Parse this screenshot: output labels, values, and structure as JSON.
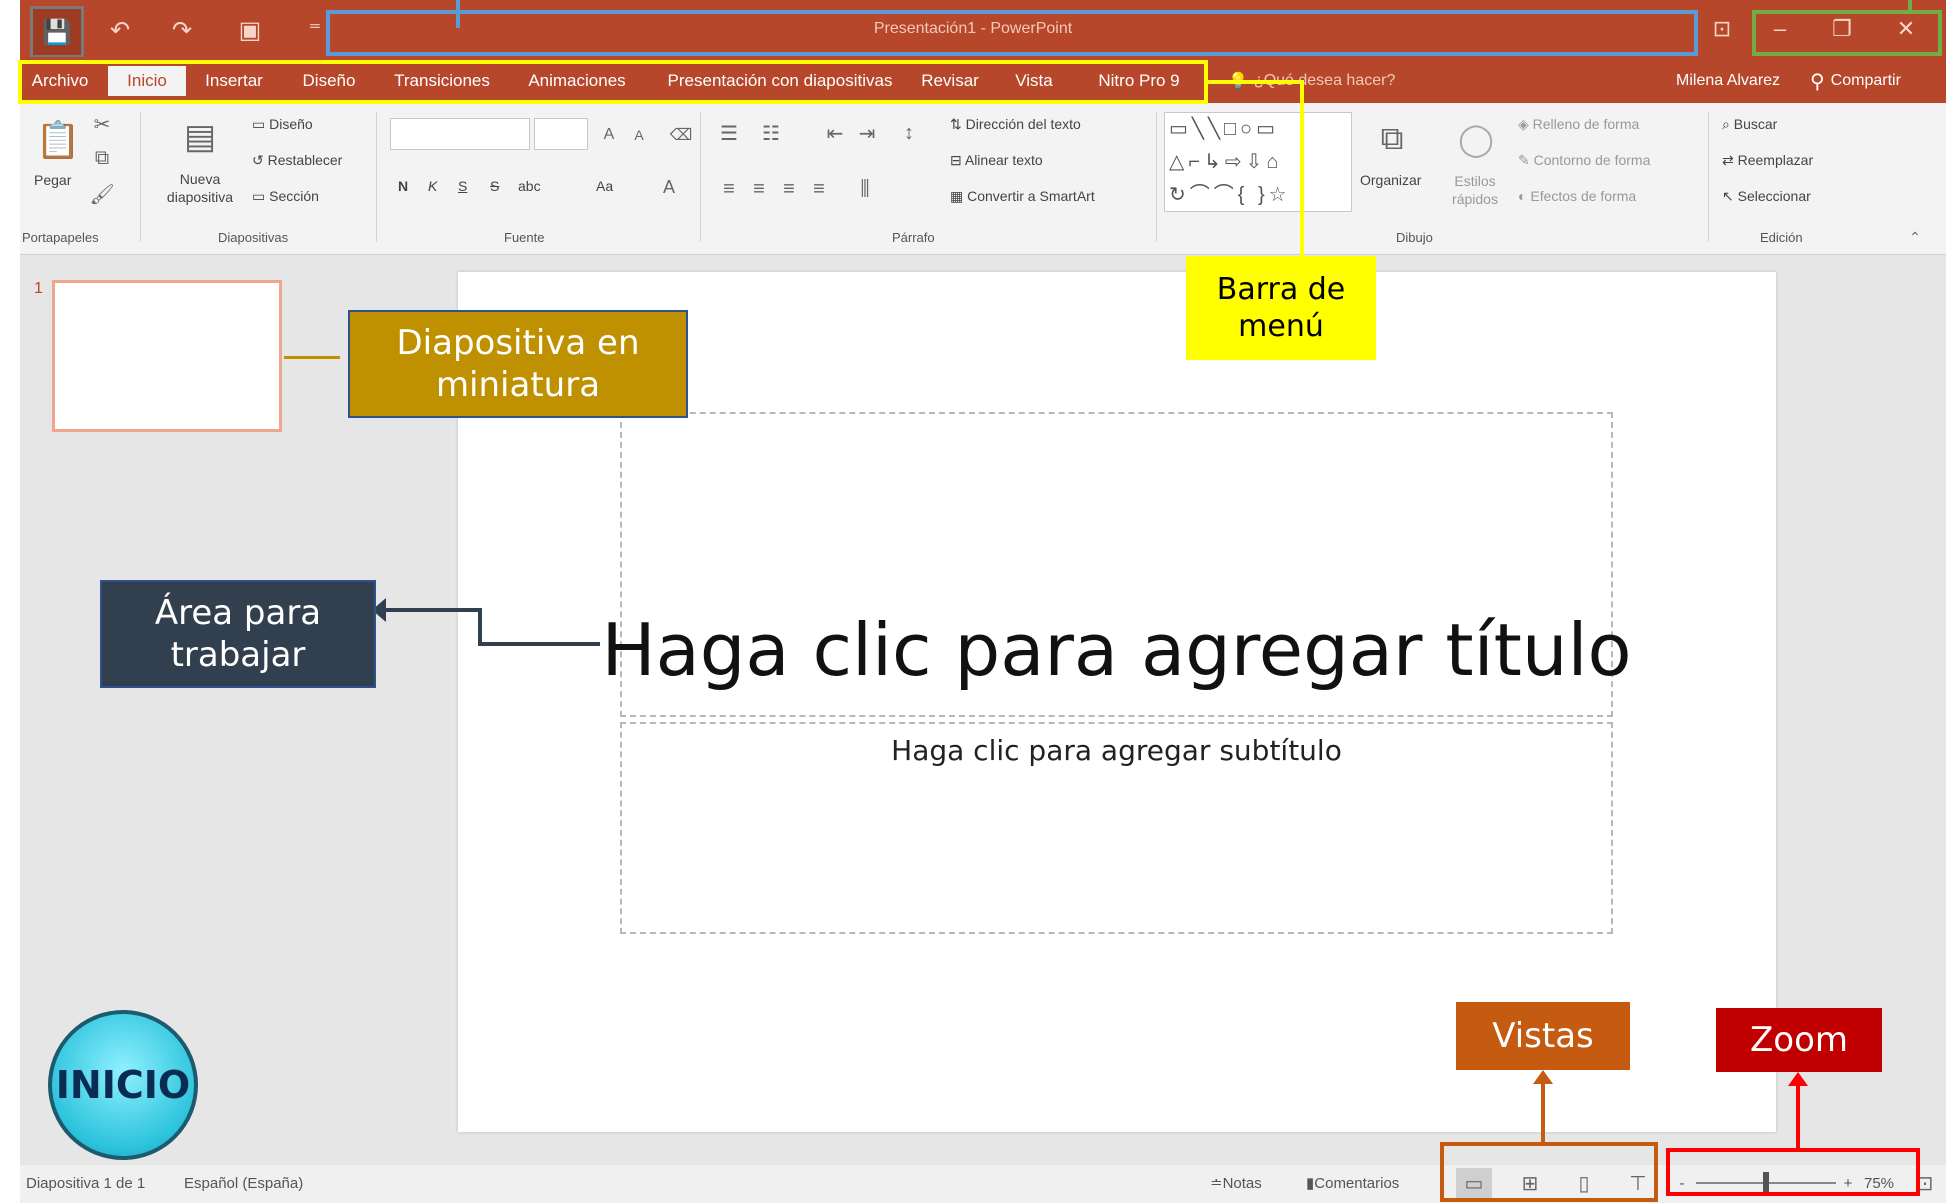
{
  "window": {
    "title": "Presentación1 - PowerPoint",
    "quick_access": {
      "save_icon": "save-icon",
      "undo_icon": "undo-icon",
      "redo_icon": "redo-icon",
      "present_icon": "present-icon",
      "customize_icon": "customize-icon"
    },
    "controls": {
      "ribbon_options": "ribbon-display-options-icon",
      "minimize": "–",
      "restore": "❐",
      "close": "✕"
    }
  },
  "tabs": [
    "Archivo",
    "Inicio",
    "Insertar",
    "Diseño",
    "Transiciones",
    "Animaciones",
    "Presentación con diapositivas",
    "Revisar",
    "Vista",
    "Nitro Pro 9"
  ],
  "active_tab": "Inicio",
  "tell_me": "¿Qué desea hacer?",
  "user_name": "Milena Alvarez",
  "share_label": "Compartir",
  "ribbon": {
    "clipboard": {
      "paste": "Pegar",
      "group": "Portapapeles"
    },
    "slides": {
      "new_slide": "Nueva diapositiva",
      "layout": "Diseño",
      "reset": "Restablecer",
      "section": "Sección",
      "group": "Diapositivas"
    },
    "font": {
      "bold": "N",
      "italic": "K",
      "underline": "S",
      "strike": "S",
      "spacing": "abc",
      "change_case": "Aa",
      "group": "Fuente"
    },
    "paragraph": {
      "text_direction": "Dirección del texto",
      "align_text": "Alinear texto",
      "smartart": "Convertir a SmartArt",
      "group": "Párrafo"
    },
    "drawing": {
      "arrange": "Organizar",
      "quick_styles": "Estilos rápidos",
      "shape_fill": "Relleno de forma",
      "shape_outline": "Contorno de forma",
      "shape_effects": "Efectos de forma",
      "group": "Dibujo"
    },
    "editing": {
      "find": "Buscar",
      "replace": "Reemplazar",
      "select": "Seleccionar",
      "group": "Edición"
    }
  },
  "thumbnail": {
    "number": "1"
  },
  "slide": {
    "title_placeholder": "Haga clic para agregar título",
    "subtitle_placeholder": "Haga clic para agregar subtítulo"
  },
  "status": {
    "slide_count": "Diapositiva 1 de 1",
    "language": "Español (España)",
    "notes": "Notas",
    "comments": "Comentarios",
    "zoom_percent": "75%",
    "zoom_minus": "-",
    "zoom_plus": "+",
    "zoom_level": 0.5
  },
  "annotations": {
    "menu_bar": "Barra de\nmenú",
    "thumbnail": "Diapositiva en\nminiatura",
    "work_area": "Área para\ntrabajar",
    "views": "Vistas",
    "zoom": "Zoom",
    "home_badge": "INICIO"
  },
  "colors": {
    "accent": "#b7472a",
    "menu_bar_callout": "#ffff00",
    "thumbnail_callout": "#bf9000",
    "work_area_callout": "#323f4f",
    "views_callout": "#c55a11",
    "zoom_callout": "#c00000",
    "title_box": "#5b9bd5",
    "window_controls_box": "#70ad47"
  }
}
